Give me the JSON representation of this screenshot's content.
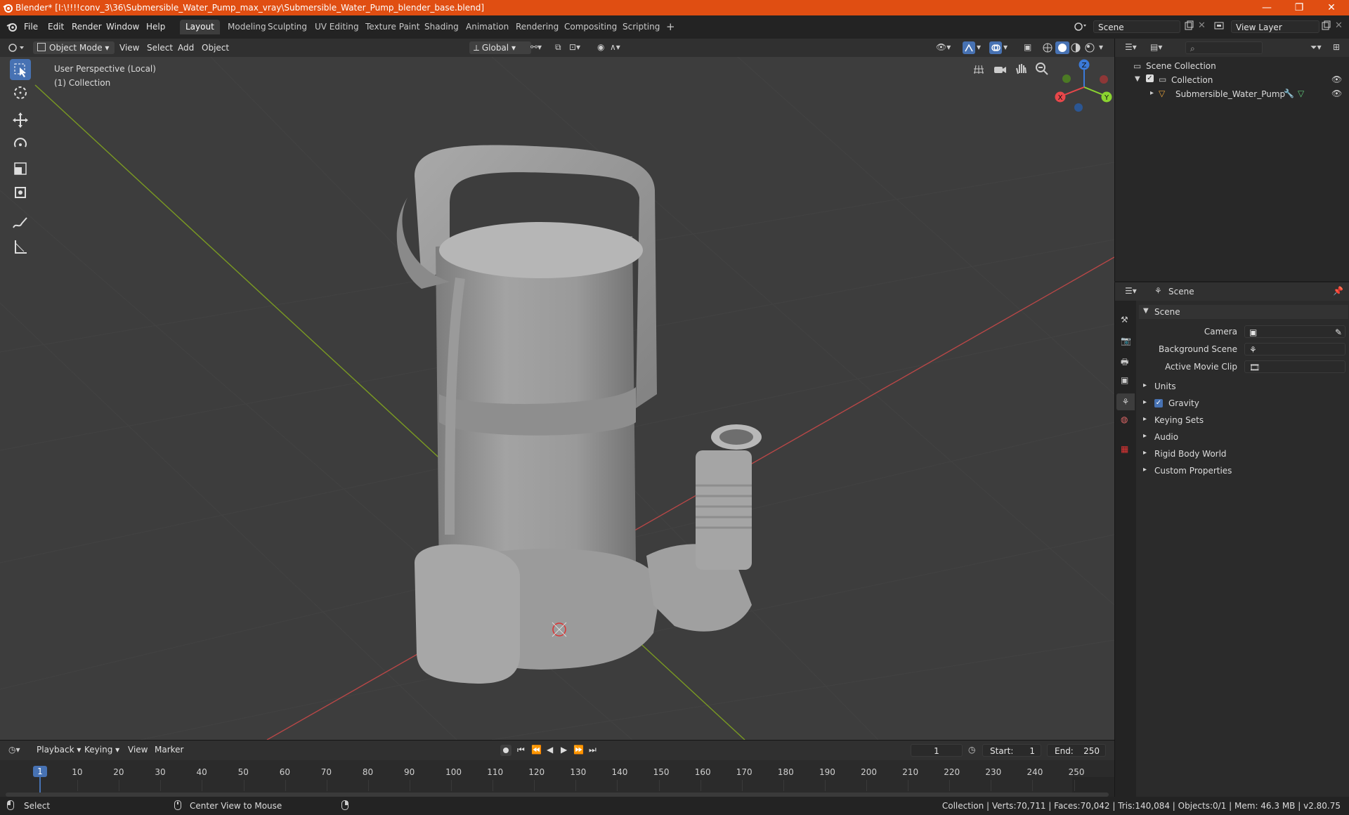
{
  "window": {
    "title": "Blender* [I:\\!!!!conv_3\\36\\Submersible_Water_Pump_max_vray\\Submersible_Water_Pump_blender_base.blend]",
    "min": "—",
    "max": "❐",
    "close": "✕"
  },
  "menu": [
    "File",
    "Edit",
    "Render",
    "Window",
    "Help"
  ],
  "workspaces": [
    "Layout",
    "Modeling",
    "Sculpting",
    "UV Editing",
    "Texture Paint",
    "Shading",
    "Animation",
    "Rendering",
    "Compositing",
    "Scripting"
  ],
  "workspace_add": "+",
  "scene_field": "Scene",
  "view_layer_field": "View Layer",
  "viewport_header": {
    "mode": "Object Mode",
    "view": "View",
    "select": "Select",
    "add": "Add",
    "object": "Object",
    "transform": "Global"
  },
  "viewport": {
    "perspective": "User Perspective (Local)",
    "collection": "(1) Collection",
    "gizmo": {
      "z": "Z",
      "y": "Y",
      "x": "X"
    }
  },
  "outliner": {
    "scene_collection": "Scene Collection",
    "collection": "Collection",
    "object": "Submersible_Water_Pump"
  },
  "properties": {
    "breadcrumb": "Scene",
    "section": "Scene",
    "camera_label": "Camera",
    "bg_scene_label": "Background Scene",
    "movie_clip_label": "Active Movie Clip",
    "panels": [
      "Units",
      "Gravity",
      "Keying Sets",
      "Audio",
      "Rigid Body World",
      "Custom Properties"
    ]
  },
  "timeline": {
    "menus": [
      "Playback",
      "Keying",
      "View",
      "Marker"
    ],
    "current_frame": "1",
    "start_label": "Start:",
    "start": "1",
    "end_label": "End:",
    "end": "250",
    "ticks": [
      "10",
      "20",
      "30",
      "40",
      "50",
      "60",
      "70",
      "80",
      "90",
      "100",
      "110",
      "120",
      "130",
      "140",
      "150",
      "160",
      "170",
      "180",
      "190",
      "200",
      "210",
      "220",
      "230",
      "240",
      "250"
    ],
    "playhead": "1"
  },
  "status": {
    "select": "Select",
    "center": "Center View to Mouse",
    "stats": "Collection | Verts:70,711 | Faces:70,042 | Tris:140,084 | Objects:0/1 | Mem: 46.3 MB | v2.80.75"
  },
  "colors": {
    "accent": "#4772b3",
    "titlebar": "#e04e12",
    "axis_x": "#e8474a",
    "axis_y": "#8bd430",
    "axis_z": "#3b7ad8"
  }
}
